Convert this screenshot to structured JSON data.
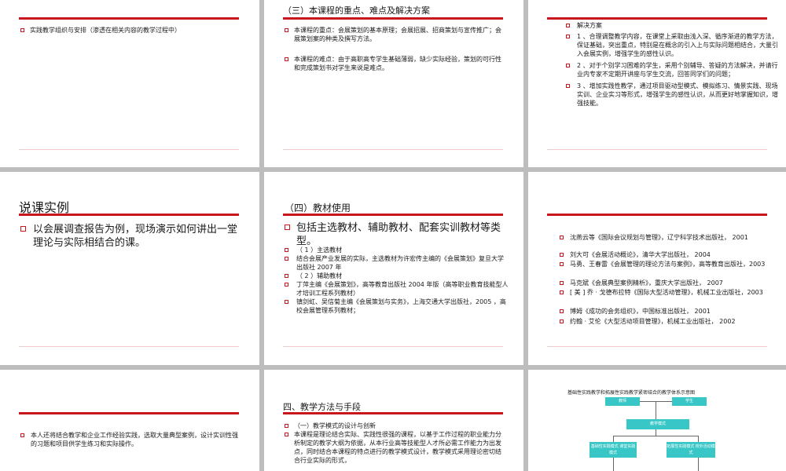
{
  "slides": {
    "s1": {
      "items": [
        "实践教学组织与安排（渗透在相关内容的教学过程中）"
      ]
    },
    "s2": {
      "title": "（三）本课程的重点、难点及解决方案",
      "items": [
        "本课程的重点：会展策划的基本原理；会展招展、招商策划与宣传推广；会展策划案的种类及撰写方法。",
        "本课程的难点：由于高职高专学生基础薄弱，缺少实际经验，策划的可行性和完成策划书对学生来说是难点。"
      ]
    },
    "s3": {
      "items": [
        "解决方案",
        "1 、合理调整教学内容，在课堂上采取由浅入深、循序渐进的教学方法，保证基础，突出重点，特别是在概念的引入上与实际问题相结合，大量引入会展实例，增强学生的感性认识。",
        "2 、对于个别学习困难的学生，采用个别辅导、答疑的方法解决，并请行业内专家不定期开讲座与学生交流，回答同学们的问题；",
        "3 、增加实践性教学，通过项目驱动型模式、模拟练习、情景实践、现场实训、企业实习等形式，增强学生的感性认识，从而更好地掌握知识，增强技能。"
      ]
    },
    "s4": {
      "title": "说课实例",
      "items": [
        "以会展调查报告为例，现场演示如何讲出一堂理论与实际相结合的课。"
      ]
    },
    "s5": {
      "title": "（四）教材使用",
      "items": [
        "包括主选教材、辅助教材、配套实训教材等类型。",
        "（ 1 ）主选教材",
        "结合会展产业发展的实际，主选教材为许宏传主编的《会展策划》复旦大学出版社 2007 年",
        "（ 2 ）辅助教材",
        "丁萍主编《会展策划》，高等教育出版社 2004 年版（高等职业教育技能型人才培训工程系列教材）",
        "镇剑虹、吴信菊主编《会展策划与实务》，上海交通大学出版社，2005 ，高校会展管理系列教材；"
      ]
    },
    "s6": {
      "items": [
        "沈燕云等《国际会议规划与管理》，辽宁科学技术出版社， 2001",
        "刘大可《会展活动概论》，清华大学出版社， 2004",
        "马勇、王春雷《会展管理的理论方法与案例》，高等教育出版社，2003",
        "马克斌《会展典型案例精析》，重庆大学出版社， 2007",
        "[ 美 ] 乔 · 戈德布拉特《国际大型活动管理》，机械工业出版社，2003",
        "博姆《成功的会务组织》，中国标准出版社， 2001",
        "约翰 · 艾伦《大型活动项目管理》，机械工业出版社， 2002"
      ]
    },
    "s7": {
      "items": [
        "本人还将结合教学和企业工作经验实践，选取大量典型案例，设计实训性强的习题和项目供学生练习和实际操作。"
      ]
    },
    "s8": {
      "title": "四、教学方法与手段",
      "items": [
        "（一）教学模式的设计与创新",
        "本课程是理论结合实际、实践性很强的课程，以基于工作过程的职业能力分析制定的教学大纲为依据，从本行业高等技能型人才所必需工作能力为出发点，同时结合本课程的特点进行的教学模式设计，教学模式采用理论密切结合行业实际的形式，"
      ]
    },
    "s9": {
      "title": "基础性实践教学和拓展性实践教学紧密结合的教学体系示意图",
      "boxes": [
        "教师",
        "学生",
        "教学模式",
        "基础性实践模式 课堂实践模式",
        "拓展性实践模式 校外活动模式"
      ]
    }
  },
  "colors": {
    "accent": "#c8161d",
    "diagram_box": "#39c6c6"
  }
}
